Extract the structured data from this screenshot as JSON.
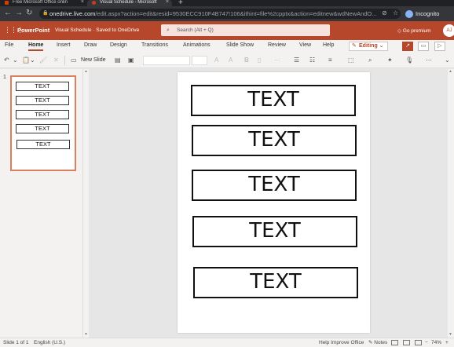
{
  "browser": {
    "tabs": [
      {
        "label": "Free Microsoft Office onlin",
        "active": false
      },
      {
        "label": "Visual Schedule - Microsoft",
        "active": true
      }
    ],
    "url_host": "onedrive.live.com",
    "url_rest": "/edit.aspx?action=edit&resid=9530ECC910F4B747!106&ithint=file%2cpptx&action=editnew&wdNewAndO...",
    "incognito_label": "Incognito"
  },
  "app": {
    "name": "PowerPoint",
    "doc_title": "Visual Schedule · Saved to OneDrive",
    "search_placeholder": "Search (Alt + Q)",
    "premium_label": "Go premium",
    "avatar_initials": "AJ",
    "brand_color": "#b7472a"
  },
  "ribbon": {
    "tabs": [
      "File",
      "Home",
      "Insert",
      "Draw",
      "Design",
      "Transitions",
      "Animations",
      "Slide Show",
      "Review",
      "View",
      "Help"
    ],
    "active_tab": "Home",
    "editing_label": "Editing",
    "new_slide_label": "New Slide"
  },
  "thumbnails": {
    "slide_number": "1",
    "boxes": [
      "TEXT",
      "TEXT",
      "TEXT",
      "TEXT",
      "TEXT"
    ]
  },
  "slide": {
    "boxes": [
      "TEXT",
      "TEXT",
      "TEXT",
      "TEXT",
      "TEXT"
    ]
  },
  "status": {
    "slide_info": "Slide 1 of 1",
    "language": "English (U.S.)",
    "help_label": "Help Improve Office",
    "notes_label": "Notes",
    "zoom": "74%"
  }
}
